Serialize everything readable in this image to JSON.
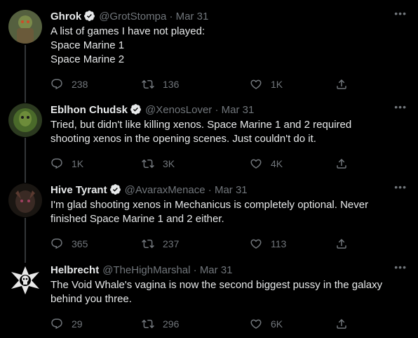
{
  "tweets": [
    {
      "name": "Ghrok",
      "handle": "@GrotStompa",
      "sep": "·",
      "date": "Mar 31",
      "lines": [
        "A list of games I have not played:",
        "Space Marine 1",
        "Space Marine 2"
      ],
      "replies": "238",
      "retweets": "136",
      "likes": "1K"
    },
    {
      "name": "Eblhon Chudsk",
      "handle": "@XenosLover",
      "sep": "·",
      "date": "Mar 31",
      "lines": [
        "Tried, but didn't like killing xenos. Space Marine 1 and 2 required",
        "shooting xenos in the opening scenes. Just couldn't do it."
      ],
      "replies": "1K",
      "retweets": "3K",
      "likes": "4K"
    },
    {
      "name": "Hive Tyrant",
      "handle": "@AvaraxMenace",
      "sep": "·",
      "date": "Mar 31",
      "lines": [
        "I'm glad shooting xenos in Mechanicus is completely optional. Never",
        "finished Space Marine 1 and 2 either."
      ],
      "replies": "365",
      "retweets": "237",
      "likes": "113"
    },
    {
      "name": "Helbrecht",
      "handle": "@TheHighMarshal",
      "sep": "·",
      "date": "Mar 31",
      "lines": [
        "The Void Whale's vagina is now the second biggest pussy in the galaxy",
        "behind you three."
      ],
      "replies": "29",
      "retweets": "296",
      "likes": "6K"
    }
  ],
  "more_label": "•••",
  "colors": {
    "background": "#000000",
    "text": "#e7e9ea",
    "muted": "#71767b",
    "thread_line": "#333639",
    "verified": "#1d9bf0"
  },
  "icons": {
    "reply": "reply-icon",
    "retweet": "retweet-icon",
    "like": "like-icon",
    "share": "share-icon",
    "verified": "verified-badge-icon",
    "more": "more-options-icon"
  }
}
